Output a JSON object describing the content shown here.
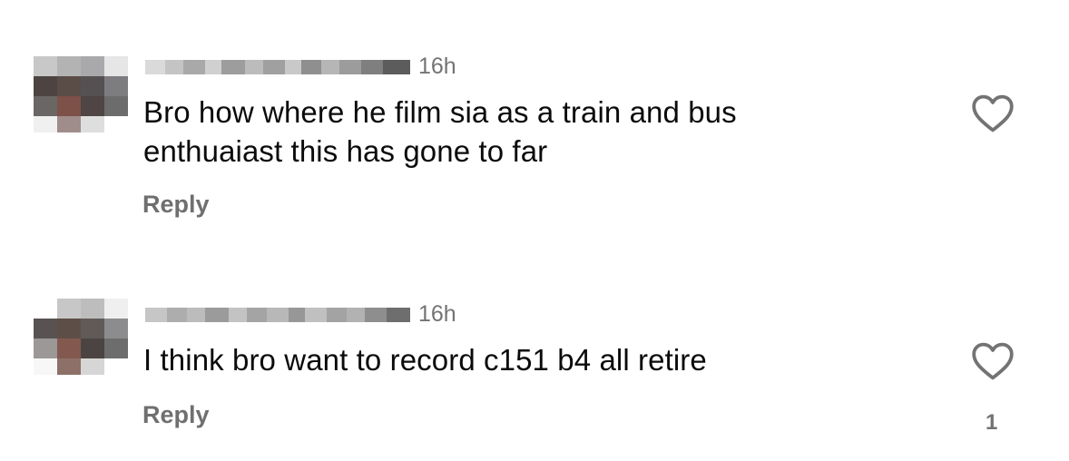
{
  "comments": [
    {
      "username": "",
      "time": "16h",
      "text_lines": [
        "Bro how where he film sia as a train and bus",
        "enthuaiast this has gone to far"
      ],
      "reply_label": "Reply",
      "like_count": ""
    },
    {
      "username": "",
      "time": "16h",
      "text_lines": [
        "I think bro want to record c151 b4 all retire"
      ],
      "reply_label": "Reply",
      "like_count": "1"
    }
  ],
  "icons": {
    "like": "heart-outline-icon"
  },
  "colors": {
    "text": "#0b0b0b",
    "secondary": "#737373",
    "heart": "#737373"
  }
}
